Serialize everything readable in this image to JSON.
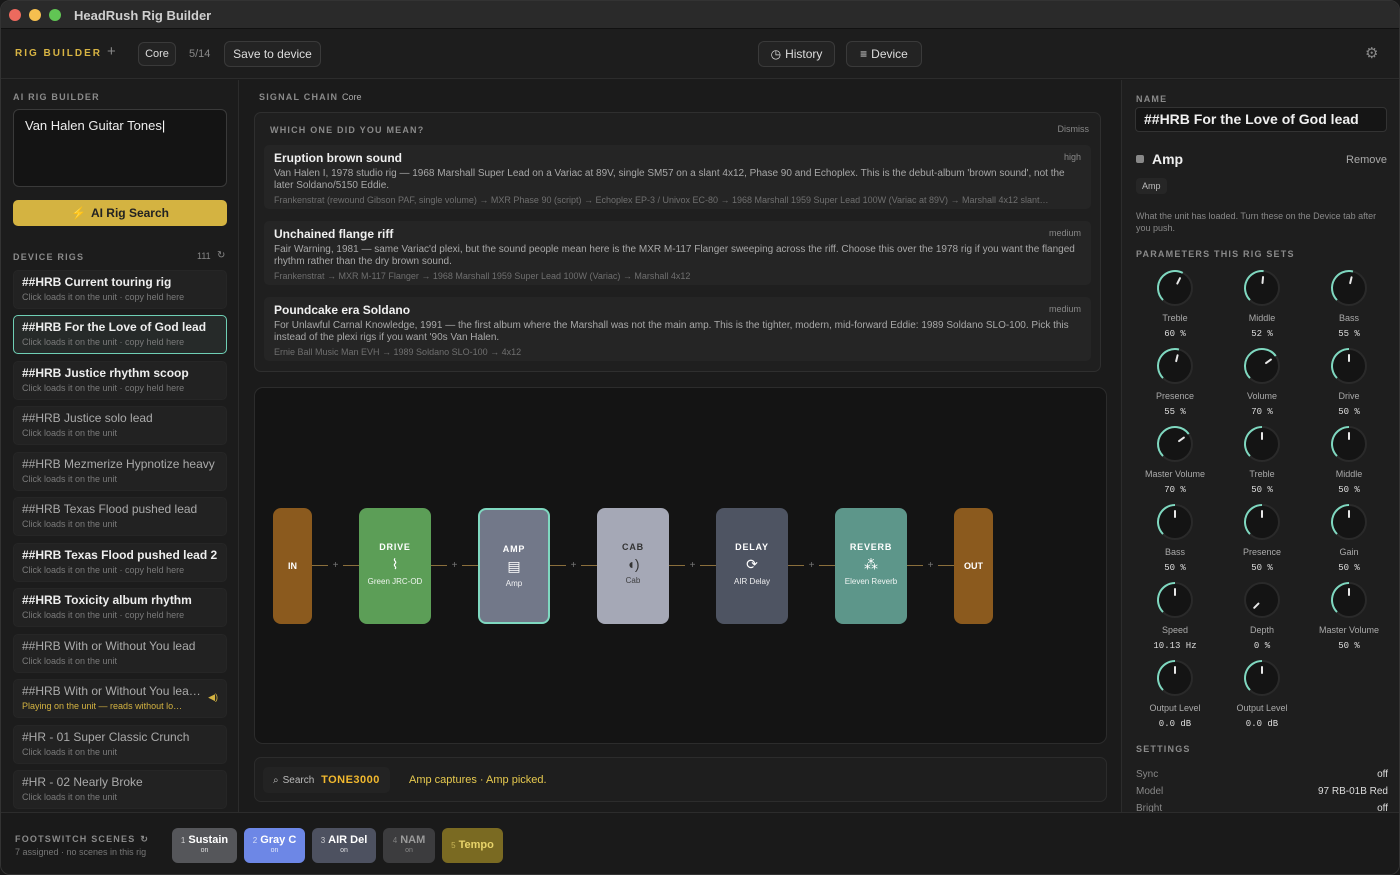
{
  "window": {
    "title": "HeadRush Rig Builder"
  },
  "toolbar": {
    "brand": "RIG BUILDER",
    "add": "+",
    "preset": "Core",
    "count": "5/14",
    "save_label": "Save to device",
    "history_label": "History",
    "device_label": "Device"
  },
  "ai": {
    "section": "AI RIG BUILDER",
    "query": "Van Halen Guitar Tones",
    "button_label": "AI Rig Search"
  },
  "rigs": {
    "section": "DEVICE RIGS",
    "count": "111",
    "items": [
      {
        "title": "##HRB Current touring rig",
        "sub": "Click loads it on the unit · copy held here"
      },
      {
        "title": "##HRB For the Love of God lead",
        "sub": "Click loads it on the unit · copy held here"
      },
      {
        "title": "##HRB Justice rhythm scoop",
        "sub": "Click loads it on the unit · copy held here"
      },
      {
        "title": "##HRB Justice solo lead",
        "sub": "Click loads it on the unit"
      },
      {
        "title": "##HRB Mezmerize Hypnotize heavy",
        "sub": "Click loads it on the unit"
      },
      {
        "title": "##HRB Texas Flood pushed lead",
        "sub": "Click loads it on the unit"
      },
      {
        "title": "##HRB Texas Flood pushed lead 2",
        "sub": "Click loads it on the unit · copy held here"
      },
      {
        "title": "##HRB Toxicity album rhythm",
        "sub": "Click loads it on the unit · copy held here"
      },
      {
        "title": "##HRB With or Without You lead",
        "sub": "Click loads it on the unit"
      },
      {
        "title": "##HRB With or Without You lea…",
        "sub": "Playing on the unit — reads without lo…"
      },
      {
        "title": "#HR - 01 Super Classic Crunch",
        "sub": "Click loads it on the unit"
      },
      {
        "title": "#HR - 02 Nearly Broke",
        "sub": "Click loads it on the unit"
      }
    ]
  },
  "chain": {
    "section": "SIGNAL CHAIN",
    "preset": "Core"
  },
  "suggest": {
    "title": "WHICH ONE DID YOU MEAN?",
    "dismiss": "Dismiss",
    "cards": [
      {
        "name": "Eruption brown sound",
        "conf": "high",
        "desc": "Van Halen I, 1978 studio rig — 1968 Marshall Super Lead on a Variac at 89V, single SM57 on a slant 4x12, Phase 90 and Echoplex. This is the debut-album 'brown sound', not the later Soldano/5150 Eddie.",
        "path": "Frankenstrat (rewound Gibson PAF, single volume) → MXR Phase 90 (script) → Echoplex EP-3 / Univox EC-80 → 1968 Marshall 1959 Super Lead 100W (Variac at 89V) → Marshall 4x12 slant…"
      },
      {
        "name": "Unchained flange riff",
        "conf": "medium",
        "desc": "Fair Warning, 1981 — same Variac'd plexi, but the sound people mean here is the MXR M-117 Flanger sweeping across the riff. Choose this over the 1978 rig if you want the flanged rhythm rather than the dry brown sound.",
        "path": "Frankenstrat → MXR M-117 Flanger → 1968 Marshall 1959 Super Lead 100W (Variac) → Marshall 4x12"
      },
      {
        "name": "Poundcake era Soldano",
        "conf": "medium",
        "desc": "For Unlawful Carnal Knowledge, 1991 — the first album where the Marshall was not the main amp. This is the tighter, modern, mid-forward Eddie: 1989 Soldano SLO-100. Pick this instead of the plexi rigs if you want '90s Van Halen.",
        "path": "Ernie Ball Music Man EVH → 1989 Soldano SLO-100 → 4x12"
      }
    ]
  },
  "blocks": {
    "in": "IN",
    "out": "OUT",
    "plus": "+",
    "items": [
      {
        "name": "DRIVE",
        "model": "Green JRC-OD",
        "icon": "waveform-icon",
        "glyph": "⌇",
        "color": "#5c9e57"
      },
      {
        "name": "AMP",
        "model": "Amp",
        "icon": "amp-icon",
        "glyph": "▤",
        "color": "#727889"
      },
      {
        "name": "CAB",
        "model": "Cab",
        "icon": "speaker-icon",
        "glyph": "🔈",
        "color": "#a5a8b6"
      },
      {
        "name": "DELAY",
        "model": "AIR Delay",
        "icon": "repeat-icon",
        "glyph": "⟳",
        "color": "#4e5462"
      },
      {
        "name": "REVERB",
        "model": "Eleven Reverb",
        "icon": "reverb-icon",
        "glyph": "⁂",
        "color": "#5d968a"
      }
    ]
  },
  "searchbar": {
    "label": "Search",
    "brand": "TONE3000",
    "status": "Amp captures · Amp picked."
  },
  "inspector": {
    "name_label": "NAME",
    "name": "##HRB For the Love of God lead",
    "block_title": "Amp",
    "remove": "Remove",
    "tag": "Amp",
    "note": "What the unit has loaded. Turn these on the Device tab after you push.",
    "params_label": "PARAMETERS THIS RIG SETS",
    "params": [
      {
        "label": "Treble",
        "value": "60 %",
        "level": 0.6
      },
      {
        "label": "Middle",
        "value": "52 %",
        "level": 0.52
      },
      {
        "label": "Bass",
        "value": "55 %",
        "level": 0.55
      },
      {
        "label": "Presence",
        "value": "55 %",
        "level": 0.55
      },
      {
        "label": "Volume",
        "value": "70 %",
        "level": 0.7
      },
      {
        "label": "Drive",
        "value": "50 %",
        "level": 0.5
      },
      {
        "label": "Master Volume",
        "value": "70 %",
        "level": 0.7
      },
      {
        "label": "Treble",
        "value": "50 %",
        "level": 0.5
      },
      {
        "label": "Middle",
        "value": "50 %",
        "level": 0.5
      },
      {
        "label": "Bass",
        "value": "50 %",
        "level": 0.5
      },
      {
        "label": "Presence",
        "value": "50 %",
        "level": 0.5
      },
      {
        "label": "Gain",
        "value": "50 %",
        "level": 0.5
      },
      {
        "label": "Speed",
        "value": "10.13 Hz",
        "level": 0.5
      },
      {
        "label": "Depth",
        "value": "0 %",
        "level": 0.0
      },
      {
        "label": "Master Volume",
        "value": "50 %",
        "level": 0.5
      },
      {
        "label": "Output Level",
        "value": "0.0 dB",
        "level": 0.5
      },
      {
        "label": "Output Level",
        "value": "0.0 dB",
        "level": 0.5
      }
    ],
    "settings_label": "SETTINGS",
    "settings": [
      {
        "label": "Sync",
        "value": "off"
      },
      {
        "label": "Model",
        "value": "97 RB-01B Red"
      },
      {
        "label": "Bright",
        "value": "off"
      }
    ]
  },
  "footswitch": {
    "title": "FOOTSWITCH SCENES",
    "sub": "7 assigned · no scenes in this rig",
    "items": [
      {
        "num": "1",
        "name": "Sustain",
        "state": "on",
        "bg": "#55565a",
        "fg": "#ffffff"
      },
      {
        "num": "2",
        "name": "Gray C",
        "state": "on",
        "bg": "#6d87e6",
        "fg": "#ffffff"
      },
      {
        "num": "3",
        "name": "AIR Del",
        "state": "on",
        "bg": "#4d5160",
        "fg": "#ffffff"
      },
      {
        "num": "4",
        "name": "NAM",
        "state": "on",
        "bg": "#3c3c3e",
        "fg": "#9a9a9a"
      },
      {
        "num": "5",
        "name": "Tempo",
        "state": "",
        "bg": "#7a6a22",
        "fg": "#e8d36a"
      }
    ]
  },
  "colors": {
    "accent": "#d4b341",
    "selected": "#6fcfb5",
    "knob": "#7fd8c0"
  }
}
